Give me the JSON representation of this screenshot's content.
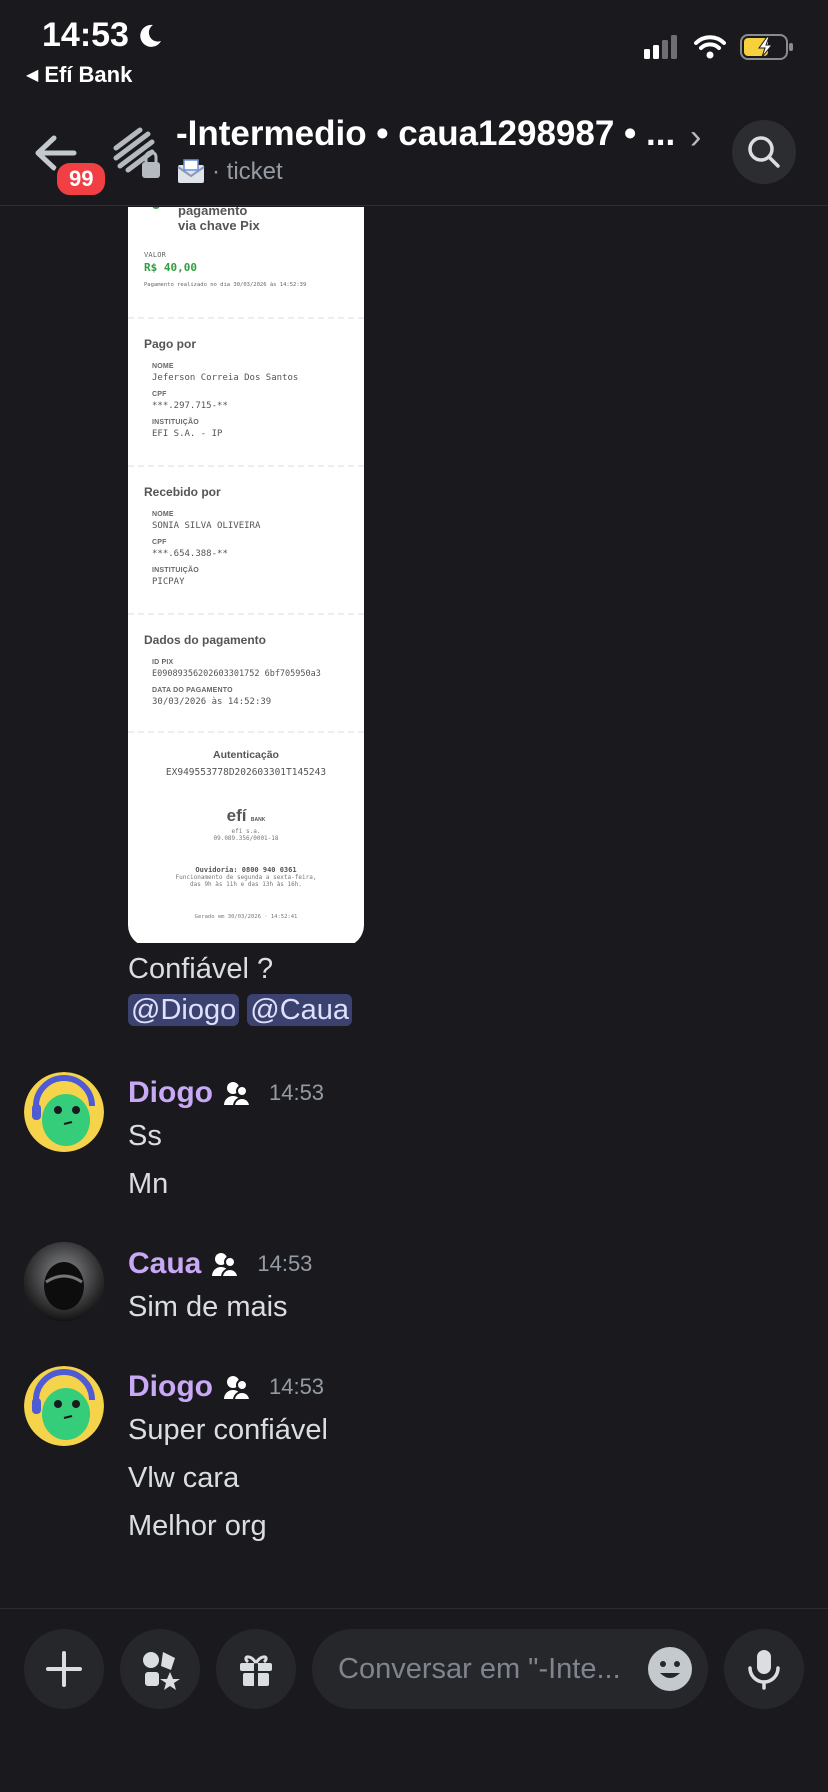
{
  "status_bar": {
    "time": "14:53",
    "back_app": "Efí Bank"
  },
  "header": {
    "badge_count": "99",
    "title": "-Intermedio • caua1298987 • ...",
    "subtitle": "· ticket"
  },
  "receipt": {
    "heading_line1": "pagamento",
    "heading_line2": "via chave Pix",
    "valor_label": "VALOR",
    "valor": "R$ 40,00",
    "realizado": "Pagamento realizado no dia 30/03/2026 às 14:52:39",
    "pago_por": {
      "title": "Pago por",
      "nome_label": "NOME",
      "nome": "Jeferson Correia Dos Santos",
      "cpf_label": "CPF",
      "cpf": "***.297.715-**",
      "inst_label": "INSTITUIÇÃO",
      "inst": "EFI S.A. - IP"
    },
    "recebido_por": {
      "title": "Recebido por",
      "nome_label": "NOME",
      "nome": "SONIA SILVA OLIVEIRA",
      "cpf_label": "CPF",
      "cpf": "***.654.388-**",
      "inst_label": "INSTITUIÇÃO",
      "inst": "PICPAY"
    },
    "dados": {
      "title": "Dados do pagamento",
      "id_label": "ID PIX",
      "id": "E09089356202603301752 6bf705950a3",
      "data_label": "DATA DO PAGAMENTO",
      "data": "30/03/2026 às 14:52:39"
    },
    "auth_title": "Autenticação",
    "auth_code": "EX949553778D202603301T145243",
    "logo": "efí",
    "logo_sub": "BANK",
    "company": "efí s.a.",
    "cnpj": "09.089.356/0001-18",
    "ouvidoria": "Ouvidoria: 0800 940 0361",
    "hours1": "Funcionamento de segunda a sexta-feira,",
    "hours2": "das 9h às 11h e das 13h às 16h.",
    "footer": "Gerado em 30/03/2026 · 14:52:41"
  },
  "messages": {
    "first_text": "Confiável ?",
    "mention1": "@Diogo",
    "mention2": "@Caua",
    "m1": {
      "author": "Diogo",
      "time": "14:53",
      "lines": [
        "Ss",
        "Mn"
      ]
    },
    "m2": {
      "author": "Caua",
      "time": "14:53",
      "lines": [
        "Sim de mais"
      ]
    },
    "m3": {
      "author": "Diogo",
      "time": "14:53",
      "lines": [
        "Super confiável",
        "Vlw cara",
        "Melhor org"
      ]
    }
  },
  "composer": {
    "placeholder": "Conversar em \"-Inte..."
  }
}
